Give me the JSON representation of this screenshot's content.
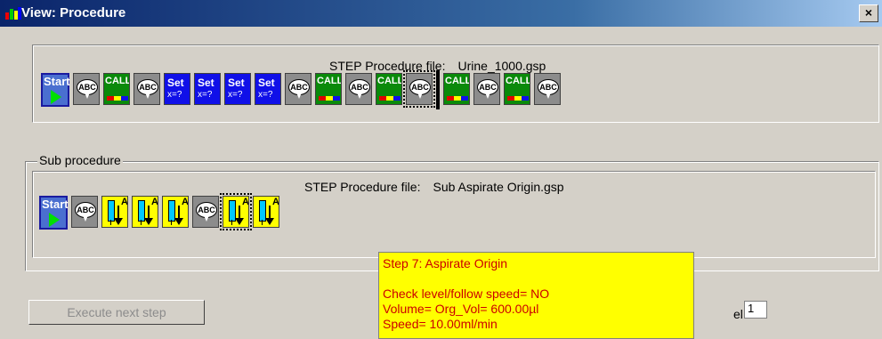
{
  "window": {
    "title": "View: Procedure",
    "close_label": "×"
  },
  "main_procedure": {
    "file_label": "STEP Procedure file:",
    "file_name": "Urine_1000.gsp",
    "steps": [
      {
        "type": "start",
        "label": "Start"
      },
      {
        "type": "abc",
        "label": "ABC"
      },
      {
        "type": "call",
        "label": "CALL"
      },
      {
        "type": "abc",
        "label": "ABC"
      },
      {
        "type": "set",
        "label": "Set",
        "sub": "x=?"
      },
      {
        "type": "set",
        "label": "Set",
        "sub": "x=?"
      },
      {
        "type": "set",
        "label": "Set",
        "sub": "x=?"
      },
      {
        "type": "set",
        "label": "Set",
        "sub": "x=?"
      },
      {
        "type": "abc",
        "label": "ABC"
      },
      {
        "type": "call",
        "label": "CALL"
      },
      {
        "type": "abc",
        "label": "ABC"
      },
      {
        "type": "call",
        "label": "CALL"
      },
      {
        "type": "abc",
        "label": "ABC",
        "selected": true
      },
      {
        "type": "call",
        "label": "CALL"
      },
      {
        "type": "abc",
        "label": "ABC"
      },
      {
        "type": "call",
        "label": "CALL"
      },
      {
        "type": "abc",
        "label": "ABC"
      }
    ]
  },
  "sub_procedure": {
    "group_label": "Sub procedure",
    "file_label": "STEP Procedure file:",
    "file_name": "Sub Aspirate Origin.gsp",
    "steps": [
      {
        "type": "start",
        "label": "Start"
      },
      {
        "type": "abc",
        "label": "ABC"
      },
      {
        "type": "aspirate",
        "label": "A"
      },
      {
        "type": "aspirate",
        "label": "A"
      },
      {
        "type": "aspirate",
        "label": "A"
      },
      {
        "type": "abc",
        "label": "ABC"
      },
      {
        "type": "aspirate",
        "label": "A",
        "selected": true
      },
      {
        "type": "aspirate",
        "label": "A"
      }
    ]
  },
  "tooltip": {
    "title": "Step 7: Aspirate Origin",
    "lines": [
      "Check level/follow speed= NO",
      "Volume= Org_Vol= 600.00µl",
      "Speed= 10.00ml/min"
    ]
  },
  "controls": {
    "execute_button": "Execute next step",
    "level_label": "el:",
    "level_value": "1"
  }
}
